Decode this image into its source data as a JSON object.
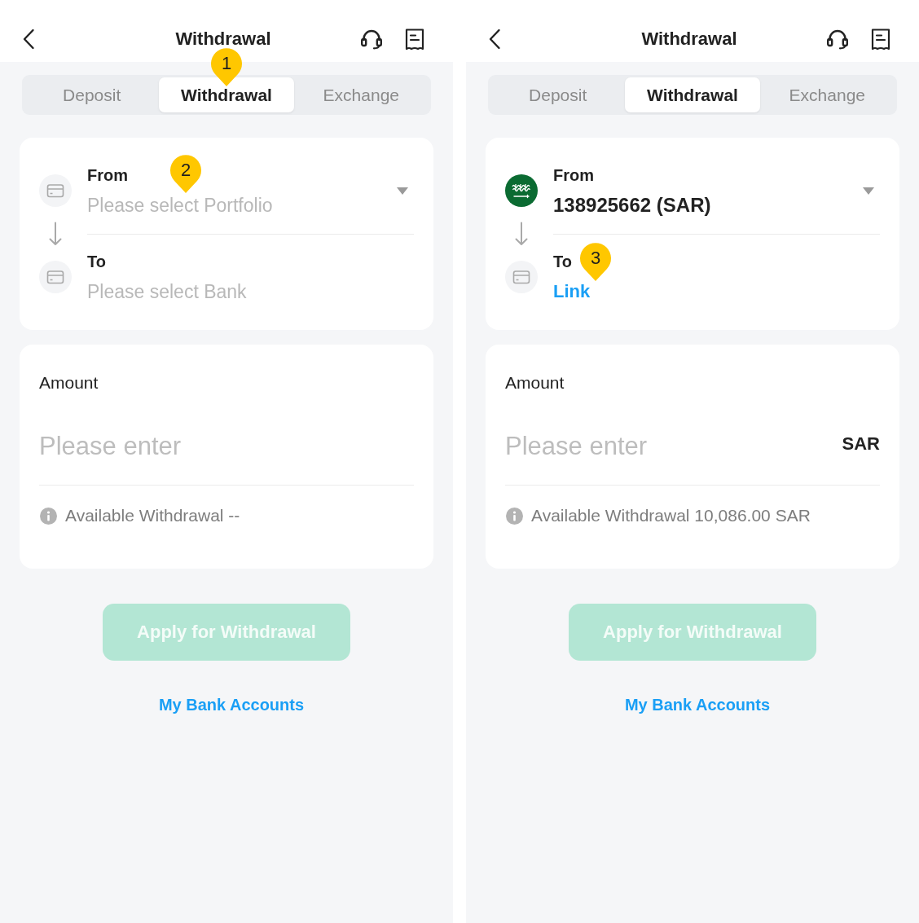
{
  "screens": [
    {
      "header": {
        "title": "Withdrawal"
      },
      "tabs": [
        {
          "label": "Deposit",
          "selected": false
        },
        {
          "label": "Withdrawal",
          "selected": true,
          "marker": "1"
        },
        {
          "label": "Exchange",
          "selected": false
        }
      ],
      "transfer": {
        "from": {
          "kind": "select",
          "label": "From",
          "placeholder": "Please select Portfolio",
          "marker": "2"
        },
        "to": {
          "kind": "select",
          "label": "To",
          "placeholder": "Please select Bank"
        }
      },
      "amount": {
        "label": "Amount",
        "placeholder": "Please enter",
        "available": "Available Withdrawal --"
      },
      "apply_button": {
        "label": "Apply for Withdrawal",
        "disabled": true
      },
      "bank_accounts_link": "My Bank Accounts"
    },
    {
      "header": {
        "title": "Withdrawal"
      },
      "tabs": [
        {
          "label": "Deposit",
          "selected": false
        },
        {
          "label": "Withdrawal",
          "selected": true
        },
        {
          "label": "Exchange",
          "selected": false
        }
      ],
      "transfer": {
        "from": {
          "kind": "account",
          "label": "From",
          "value": "138925662 (SAR)"
        },
        "to": {
          "kind": "link",
          "label": "To",
          "link": "Link",
          "marker": "3"
        }
      },
      "amount": {
        "label": "Amount",
        "placeholder": "Please enter",
        "unit": "SAR",
        "available": "Available Withdrawal 10,086.00 SAR"
      },
      "apply_button": {
        "label": "Apply for Withdrawal",
        "disabled": true
      },
      "bank_accounts_link": "My Bank Accounts"
    }
  ]
}
